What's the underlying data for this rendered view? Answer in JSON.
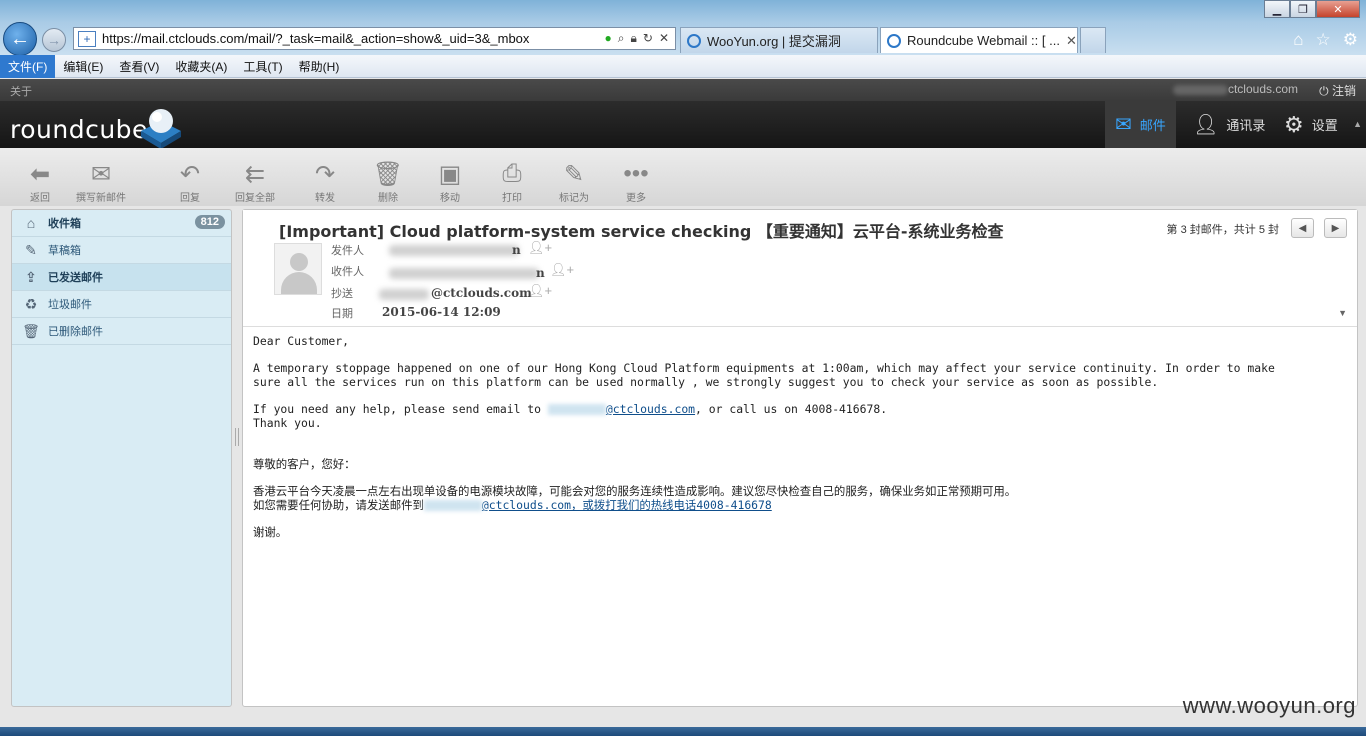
{
  "window": {
    "minimize_icon": "minimize-icon",
    "maximize_icon": "maximize-icon",
    "close_icon": "close-icon"
  },
  "browser": {
    "url": "https://mail.ctclouds.com/mail/?_task=mail&_action=show&_uid=3&_mbox",
    "tabs": [
      {
        "label": "WooYun.org | 提交漏洞"
      },
      {
        "label": "Roundcube Webmail :: [ ...",
        "close": "✕"
      }
    ],
    "menu": [
      "文件(F)",
      "编辑(E)",
      "查看(V)",
      "收藏夹(A)",
      "工具(T)",
      "帮助(H)"
    ]
  },
  "topline": {
    "about": "关于",
    "user": "ctclouds.com",
    "logout": "注销"
  },
  "header": {
    "logo": "roundcube",
    "tasks": [
      {
        "label": "邮件",
        "icon": "mail-icon"
      },
      {
        "label": "通讯录",
        "icon": "contacts-icon"
      },
      {
        "label": "设置",
        "icon": "settings-icon"
      }
    ]
  },
  "toolbar": {
    "back": "返回",
    "compose": "撰写新邮件",
    "reply": "回复",
    "reply_all": "回复全部",
    "forward": "转发",
    "delete": "删除",
    "move": "移动",
    "print": "打印",
    "mark": "标记为",
    "more": "更多"
  },
  "folders": [
    {
      "label": "收件箱",
      "count": "812",
      "icon": "inbox-icon"
    },
    {
      "label": "草稿箱",
      "icon": "drafts-icon"
    },
    {
      "label": "已发送邮件",
      "icon": "sent-icon"
    },
    {
      "label": "垃圾邮件",
      "icon": "junk-icon"
    },
    {
      "label": "已删除邮件",
      "icon": "trash-icon"
    }
  ],
  "message": {
    "subject": "[Important] Cloud platform-system service checking 【重要通知】云平台-系统业务检查",
    "counter": "第 3 封邮件，共计 5 封",
    "labels": {
      "from": "发件人",
      "to": "收件人",
      "cc": "抄送",
      "date": "日期"
    },
    "from_tail": "n",
    "to_tail": "n",
    "cc": "@ctclouds.com",
    "date": "2015-06-14 12:09",
    "body": {
      "greeting": "Dear Customer,",
      "para1": "A temporary stoppage happened on one of our Hong Kong Cloud Platform equipments at 1:00am, which may affect your service continuity. In order to make\nsure all the services run on this platform can be used normally , we strongly suggest you to check your service as soon as possible.",
      "help_prefix": "If you need any help, please send email to ",
      "help_link": "@ctclouds.com",
      "help_suffix": ", or call us on 4008-416678.",
      "thanks": "Thank you.",
      "cn_greeting": "尊敬的客户，您好：",
      "cn_para": "香港云平台今天凌晨一点左右出现单设备的电源模块故障，可能会对您的服务连续性造成影响。建议您尽快检查自己的服务，确保业务如正常预期可用。",
      "cn_help_prefix": "如您需要任何协助，请发送邮件到",
      "cn_help_link": "@ctclouds.com，或拨打我们的热线电话4008-416678",
      "cn_thanks": "谢谢。"
    }
  },
  "watermark": "www.wooyun.org"
}
